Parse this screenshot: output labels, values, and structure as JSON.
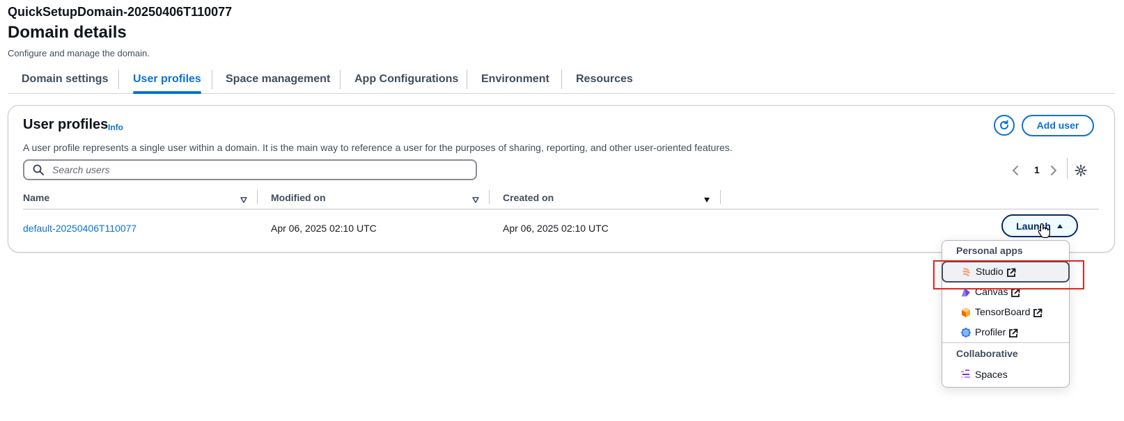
{
  "header": {
    "domain_name": "QuickSetupDomain-20250406T110077",
    "title": "Domain details",
    "description": "Configure and manage the domain."
  },
  "tabs": [
    {
      "label": "Domain settings",
      "active": false
    },
    {
      "label": "User profiles",
      "active": true
    },
    {
      "label": "Space management",
      "active": false
    },
    {
      "label": "App Configurations",
      "active": false
    },
    {
      "label": "Environment",
      "active": false
    },
    {
      "label": "Resources",
      "active": false
    }
  ],
  "panel": {
    "title": "User profiles",
    "info_label": "Info",
    "description": "A user profile represents a single user within a domain. It is the main way to reference a user for the purposes of sharing, reporting, and other user-oriented features.",
    "add_user_label": "Add user",
    "search_placeholder": "Search users",
    "search_value": "",
    "page_number": "1"
  },
  "table": {
    "columns": [
      "Name",
      "Modified on",
      "Created on"
    ],
    "rows": [
      {
        "name": "default-20250406T110077",
        "modified_on": "Apr 06, 2025 02:10 UTC",
        "created_on": "Apr 06, 2025 02:10 UTC",
        "action_label": "Launch"
      }
    ]
  },
  "launch_menu": {
    "groups": [
      {
        "label": "Personal apps",
        "items": [
          {
            "label": "Studio",
            "icon": "studio-icon",
            "external": true,
            "highlighted": true
          },
          {
            "label": "Canvas",
            "icon": "canvas-icon",
            "external": true
          },
          {
            "label": "TensorBoard",
            "icon": "tensorboard-icon",
            "external": true
          },
          {
            "label": "Profiler",
            "icon": "profiler-icon",
            "external": true
          }
        ]
      },
      {
        "label": "Collaborative",
        "items": [
          {
            "label": "Spaces",
            "icon": "spaces-icon",
            "external": false
          }
        ]
      }
    ]
  },
  "colors": {
    "primary": "#0972d3",
    "launch_border": "#002b66",
    "highlight_red": "#e02424",
    "text": "#0f141a"
  }
}
